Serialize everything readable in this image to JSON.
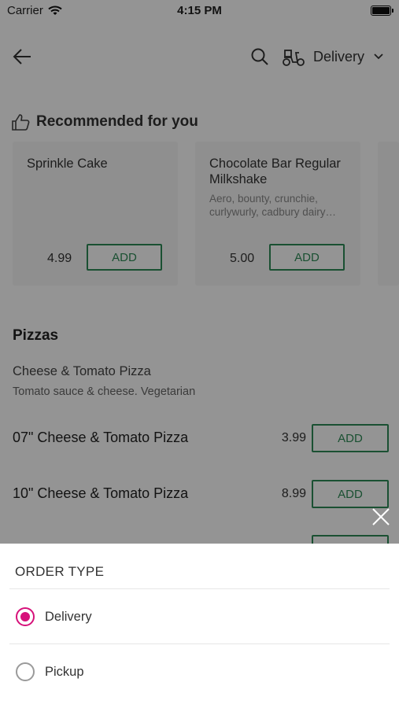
{
  "status_bar": {
    "carrier": "Carrier",
    "time": "4:15 PM"
  },
  "header": {
    "order_type_label": "Delivery"
  },
  "recommended": {
    "title": "Recommended for you",
    "items": [
      {
        "name": "Sprinkle Cake",
        "description": "",
        "price": "4.99",
        "add_label": "ADD"
      },
      {
        "name": "Chocolate Bar Regular Milkshake",
        "description": "Aero, bounty, crunchie, curlywurly, cadbury dairy…",
        "price": "5.00",
        "add_label": "ADD"
      }
    ]
  },
  "menu": {
    "section_title": "Pizzas",
    "group": {
      "title": "Cheese & Tomato Pizza",
      "description": "Tomato sauce & cheese. Vegetarian",
      "items": [
        {
          "name": "07\" Cheese & Tomato Pizza",
          "price": "3.99",
          "add_label": "ADD"
        },
        {
          "name": "10\" Cheese & Tomato Pizza",
          "price": "8.99",
          "add_label": "ADD"
        }
      ]
    }
  },
  "order_sheet": {
    "title": "ORDER TYPE",
    "options": [
      {
        "label": "Delivery",
        "selected": true
      },
      {
        "label": "Pickup",
        "selected": false
      }
    ],
    "accent_color": "#d6117a"
  },
  "colors": {
    "add_button": "#2e8b57",
    "overlay": "rgba(0,0,0,0.42)"
  }
}
